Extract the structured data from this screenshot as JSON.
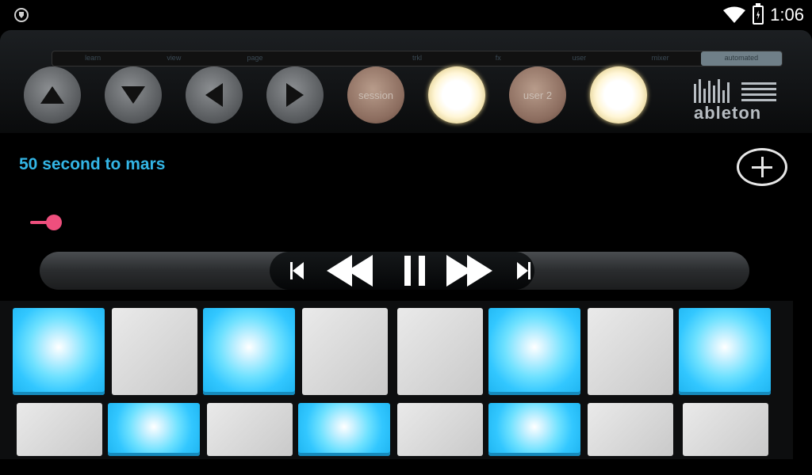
{
  "status_bar": {
    "time": "1:06",
    "icons": [
      "shield-icon",
      "wifi-icon",
      "battery-charging-icon"
    ]
  },
  "controller": {
    "mode_tabs": [
      "learn",
      "view",
      "page",
      "",
      "trkl",
      "fx",
      "user",
      "mixer",
      "automated"
    ],
    "round_buttons": [
      {
        "name": "up-arrow-button",
        "icon": "up-arrow-icon",
        "label": ""
      },
      {
        "name": "down-arrow-button",
        "icon": "down-arrow-icon",
        "label": ""
      },
      {
        "name": "left-arrow-button",
        "icon": "left-arrow-icon",
        "label": ""
      },
      {
        "name": "right-arrow-button",
        "icon": "right-arrow-icon",
        "label": ""
      },
      {
        "name": "session-button",
        "icon": "",
        "label": "session"
      },
      {
        "name": "lit-button-1",
        "icon": "",
        "label": ""
      },
      {
        "name": "user2-button",
        "icon": "",
        "label": "user 2"
      },
      {
        "name": "lit-button-2",
        "icon": "",
        "label": ""
      }
    ],
    "logo_text": "ableton"
  },
  "track": {
    "title": "50 second to mars",
    "progress": 0.0
  },
  "transport": {
    "icons": [
      "skip-previous-icon",
      "rewind-icon",
      "pause-icon",
      "fast-forward-icon",
      "skip-next-icon"
    ]
  },
  "pads": {
    "row1": [
      "blue",
      "gray",
      "blue",
      "gray",
      "gray",
      "blue",
      "gray",
      "blue"
    ],
    "row2": [
      "gray",
      "blue",
      "gray",
      "blue",
      "gray",
      "blue",
      "gray",
      "gray"
    ]
  },
  "colors": {
    "accent": "#33b5e5",
    "seek": "#ee4f7d",
    "pad_blue": "#32c7ff",
    "pad_gray": "#d8d8d8"
  }
}
